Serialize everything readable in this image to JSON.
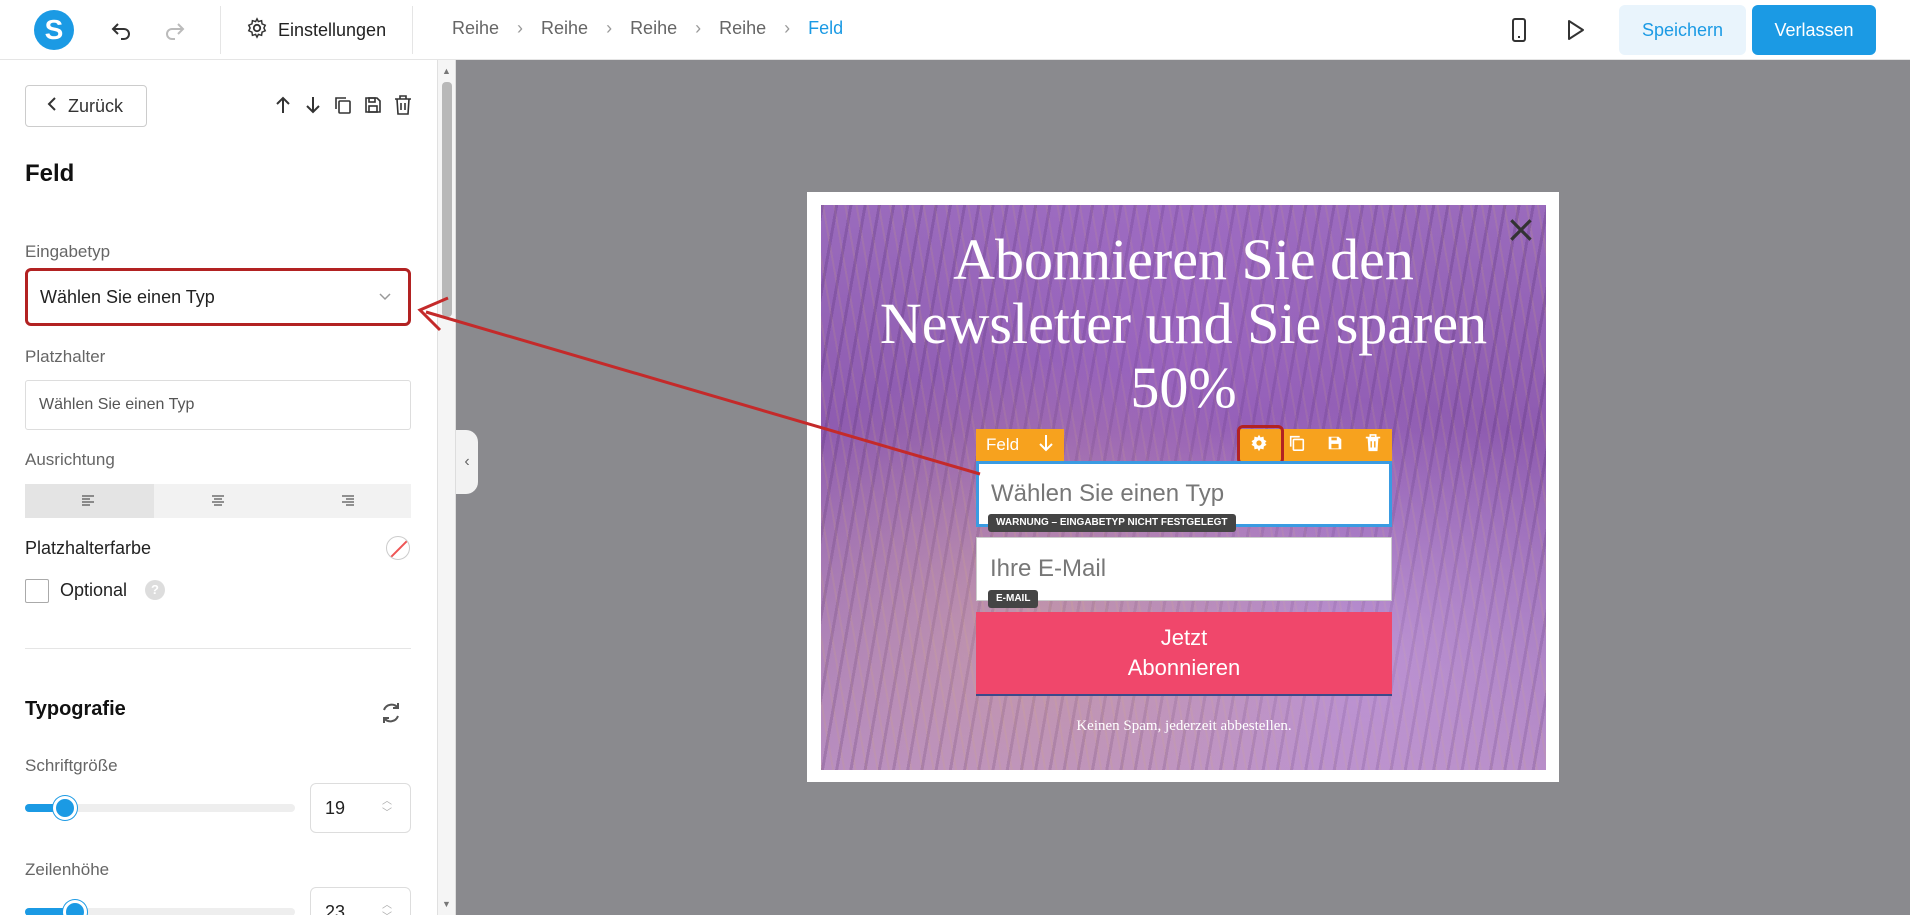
{
  "toolbar": {
    "logo": "S",
    "undo_icon": "undo-icon",
    "redo_icon": "redo-icon",
    "settings_label": "Einstellungen",
    "breadcrumbs": [
      "Reihe",
      "Reihe",
      "Reihe",
      "Reihe",
      "Feld"
    ],
    "save_label": "Speichern",
    "leave_label": "Verlassen",
    "accent": "#1b9ae4"
  },
  "panel": {
    "back_label": "Zurück",
    "title": "Feld",
    "input_type_label": "Eingabetyp",
    "input_type_value": "Wählen Sie einen Typ",
    "placeholder_label": "Platzhalter",
    "placeholder_value": "Wählen Sie einen Typ",
    "alignment_label": "Ausrichtung",
    "placeholder_color_label": "Platzhalterfarbe",
    "optional_label": "Optional",
    "help_glyph": "?",
    "typography_title": "Typografie",
    "font_size_label": "Schriftgröße",
    "font_size_value": "19",
    "line_height_label": "Zeilenhöhe",
    "line_height_value": "23"
  },
  "popup": {
    "headline_line1": "Abonnieren Sie den",
    "headline_line2": "Newsletter und Sie sparen",
    "headline_line3": "50%",
    "field_tag": "Feld",
    "field_placeholder": "Wählen Sie einen Typ",
    "warning_badge": "WARNUNG – EINGABETYP NICHT FESTGELEGT",
    "email_placeholder": "Ihre E-Mail",
    "email_badge": "E-MAIL",
    "button_line1": "Jetzt",
    "button_line2": "Abonnieren",
    "footnote": "Keinen Spam, jederzeit abbestellen.",
    "button_color": "#f0476b",
    "toolbar_color": "#f7a21e",
    "highlight_color": "#b22222"
  }
}
